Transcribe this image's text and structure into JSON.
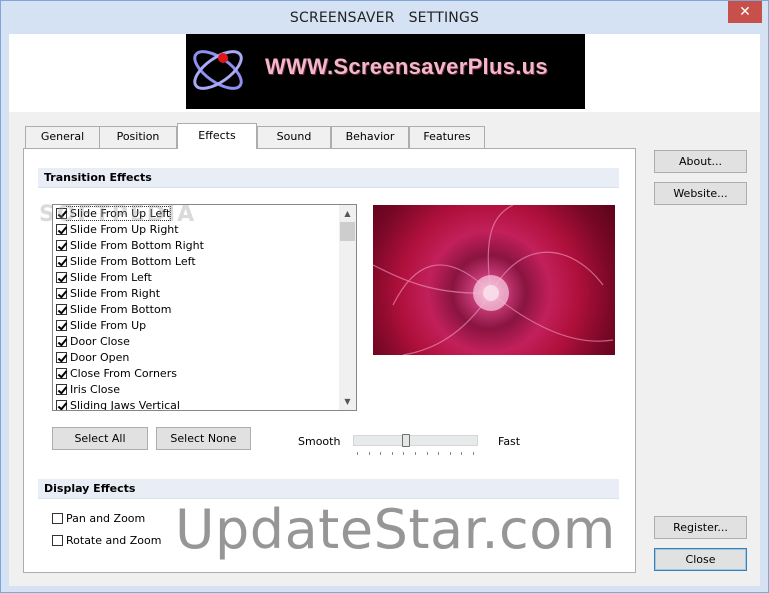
{
  "window": {
    "title": "SCREENSAVER   SETTINGS",
    "close_glyph": "✕"
  },
  "banner": {
    "text": "WWW.ScreensaverPlus.us",
    "logo_icon": "atom-logo-icon"
  },
  "tabs": [
    {
      "label": "General",
      "active": false
    },
    {
      "label": "Position",
      "active": false
    },
    {
      "label": "Effects",
      "active": true
    },
    {
      "label": "Sound",
      "active": false
    },
    {
      "label": "Behavior",
      "active": false
    },
    {
      "label": "Features",
      "active": false
    }
  ],
  "transition": {
    "heading": "Transition Effects",
    "items": [
      {
        "label": "Slide From Up Left",
        "checked": true
      },
      {
        "label": "Slide From Up Right",
        "checked": true
      },
      {
        "label": "Slide From Bottom Right",
        "checked": true
      },
      {
        "label": "Slide From Bottom Left",
        "checked": true
      },
      {
        "label": "Slide From Left",
        "checked": true
      },
      {
        "label": "Slide From Right",
        "checked": true
      },
      {
        "label": "Slide From Bottom",
        "checked": true
      },
      {
        "label": "Slide From Up",
        "checked": true
      },
      {
        "label": "Door Close",
        "checked": true
      },
      {
        "label": "Door Open",
        "checked": true
      },
      {
        "label": "Close From Corners",
        "checked": true
      },
      {
        "label": "Iris Close",
        "checked": true
      },
      {
        "label": "Sliding Jaws Vertical",
        "checked": true
      }
    ],
    "select_all": "Select All",
    "select_none": "Select None",
    "speed_min_label": "Smooth",
    "speed_max_label": "Fast",
    "speed_fraction": 0.42
  },
  "display": {
    "heading": "Display Effects",
    "items": [
      {
        "label": "Pan and Zoom",
        "checked": false
      },
      {
        "label": "Rotate and Zoom",
        "checked": false
      }
    ]
  },
  "side_buttons": {
    "about": "About...",
    "website": "Website...",
    "register": "Register...",
    "close": "Close"
  },
  "watermarks": {
    "main": "UpdateStar.com",
    "faint": "SOFTPEDIA"
  },
  "colors": {
    "window_frame": "#d5e2f4",
    "section_band": "#e9eef6",
    "close_red": "#c7504a"
  }
}
